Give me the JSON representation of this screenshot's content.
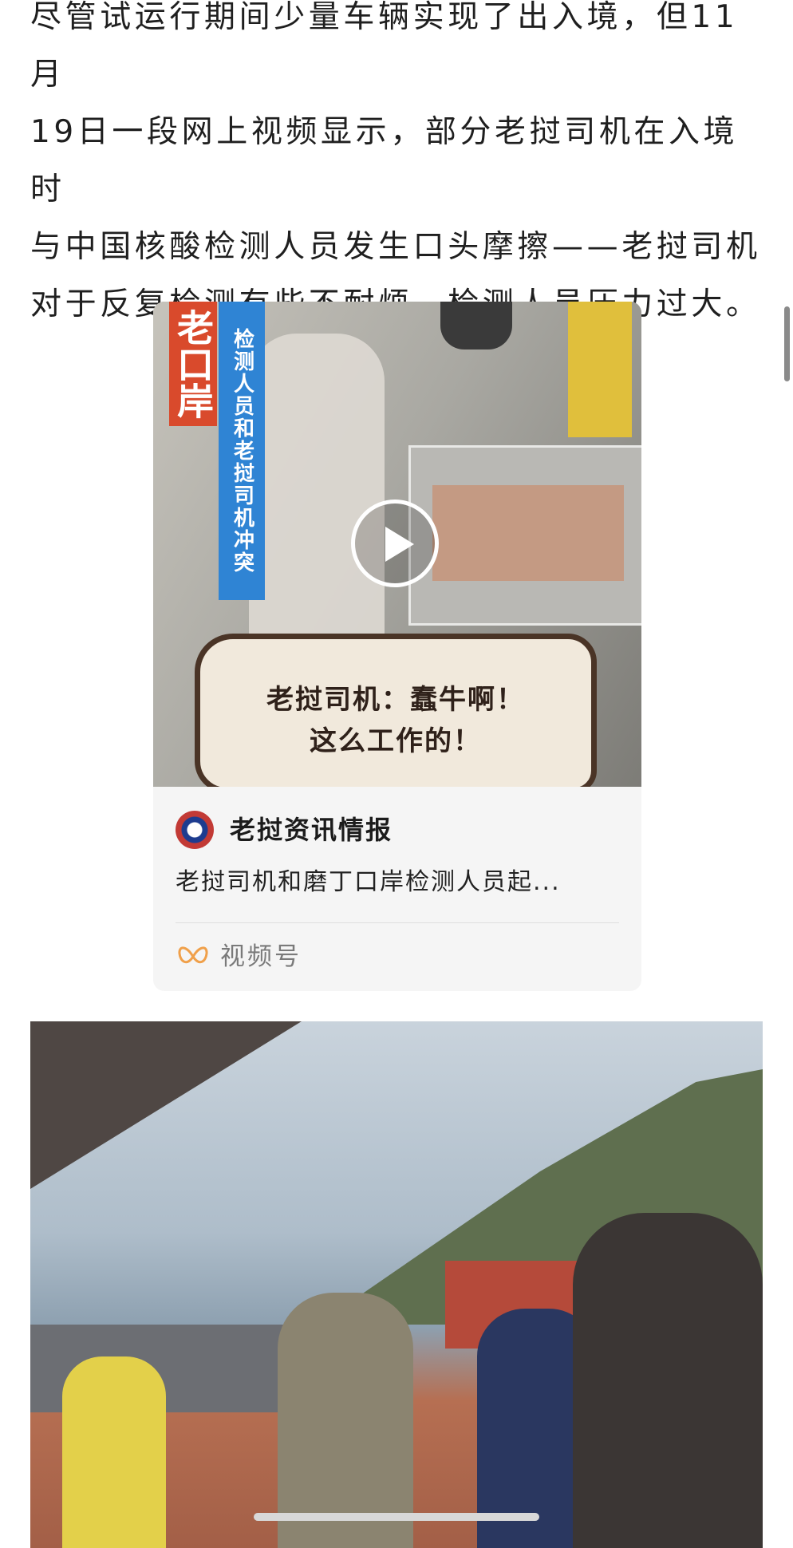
{
  "article": {
    "lines": [
      "尽管试运行期间少量车辆实现了出入境，但11月",
      "19日一段网上视频显示，部分老挝司机在入境时",
      "与中国核酸检测人员发生口头摩擦——老挝司机",
      "对于反复检测有些不耐烦，检测人员压力过大。"
    ]
  },
  "video_card": {
    "thumbnail": {
      "red_tag": "老口岸",
      "blue_tag": "检测人员和老挝司机冲突",
      "caption_line1": "老挝司机：蠢牛啊！",
      "caption_line2": "这么工作的！"
    },
    "channel_name": "老挝资讯情报",
    "description": "老挝司机和磨丁口岸检测人员起...",
    "source_label": "视频号",
    "icons": {
      "play": "play-icon",
      "avatar": "laos-flag-avatar",
      "source": "channels-butterfly-icon"
    },
    "colors": {
      "red_tag": "#d94a2c",
      "blue_tag": "#2f84d4",
      "source_icon": "#f0a04a"
    }
  }
}
